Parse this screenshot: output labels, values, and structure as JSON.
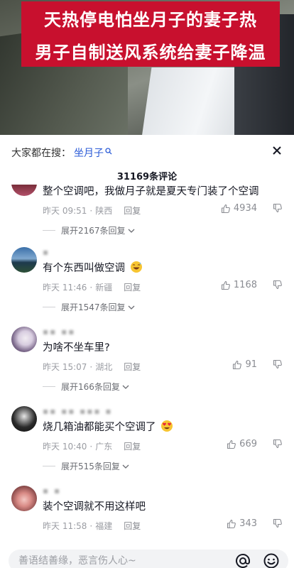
{
  "video": {
    "headline_1": "天热停电怕坐月子的妻子热",
    "headline_2": "男子自制送风系统给妻子降温"
  },
  "search": {
    "prefix": "大家都在搜：",
    "term": "坐月子"
  },
  "comment_count": "31169条评论",
  "comments": [
    {
      "text": "整个空调吧，我做月子就是夏天专门装了个空调",
      "time": "昨天 09:51",
      "location": "陕西",
      "reply": "回复",
      "likes": "4934",
      "expand": "展开2167条回复"
    },
    {
      "username": "▪",
      "text": "有个东西叫做空调",
      "time": "昨天 11:46",
      "location": "新疆",
      "reply": "回复",
      "likes": "1168",
      "expand": "展开1547条回复"
    },
    {
      "username": "▪▪ ▪▪",
      "text": "为啥不坐车里?",
      "time": "昨天 15:07",
      "location": "湖北",
      "reply": "回复",
      "likes": "91",
      "expand": "展开166条回复"
    },
    {
      "username": "▪▪ ▪▪ ▪▪▪ ▪",
      "text": "烧几箱油都能买个空调了",
      "time": "昨天 10:40",
      "location": "广东",
      "reply": "回复",
      "likes": "669",
      "expand": "展开515条回复"
    },
    {
      "username": "▪ ▪",
      "text": "装个空调就不用这样吧",
      "time": "昨天 11:58",
      "location": "福建",
      "reply": "回复",
      "likes": "343"
    }
  ],
  "input": {
    "placeholder": "善语结善缘，恶言伤人心~"
  },
  "colors": {
    "accent_link": "#2b5bd7",
    "headline_bg": "#c8102e"
  }
}
